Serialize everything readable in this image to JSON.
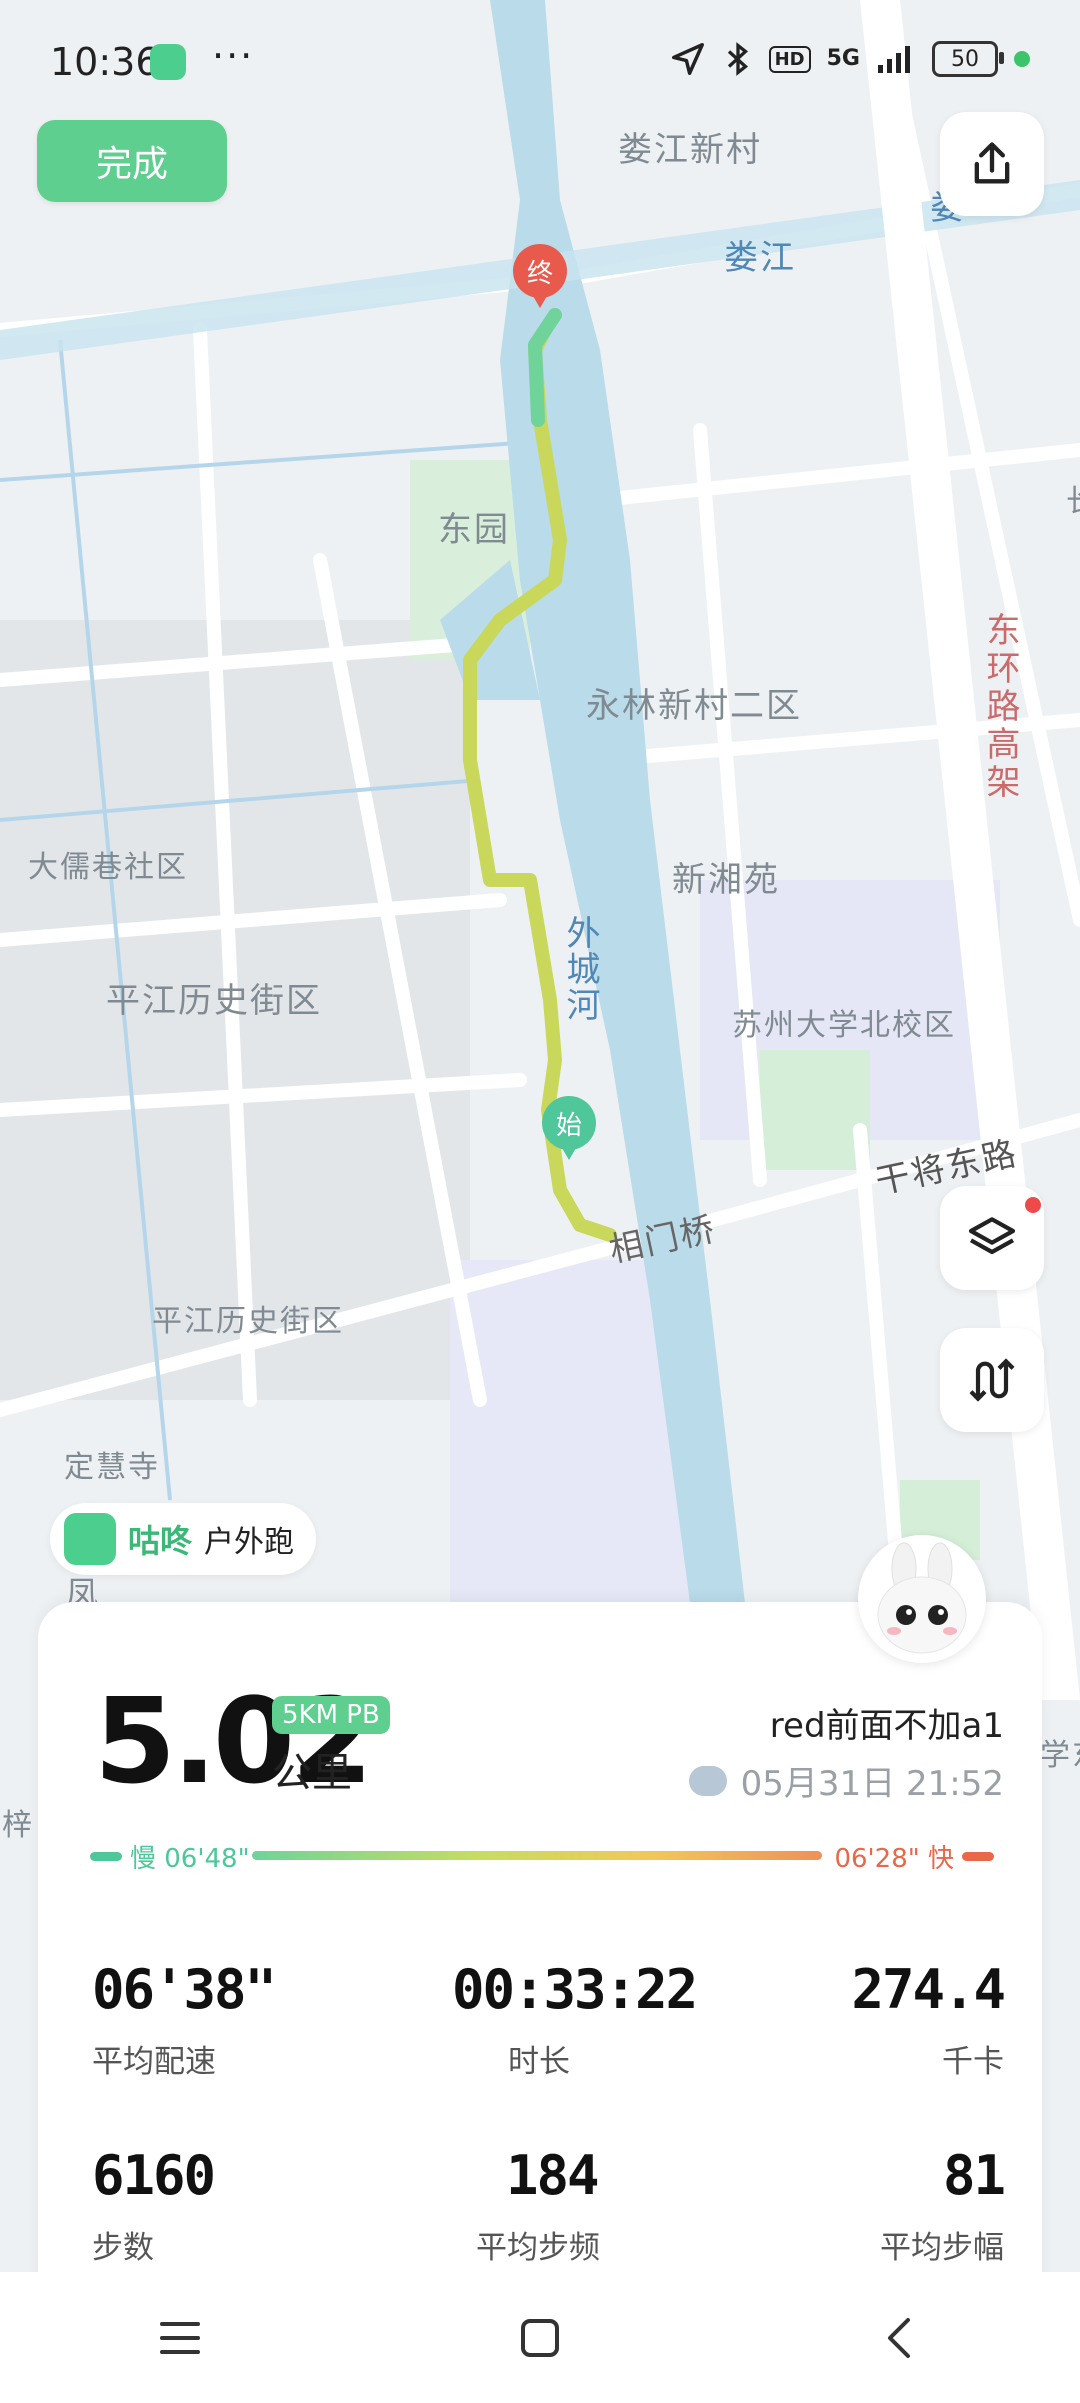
{
  "status_bar": {
    "time": "10:36",
    "more": "···",
    "net": "5G",
    "hd": "HD",
    "battery": "50"
  },
  "actions": {
    "done_label": "完成"
  },
  "map": {
    "labels": {
      "loujiang_village": "娄江新村",
      "loujiang": "娄江",
      "loujiang_edge": "娄",
      "dongyuan": "东园",
      "yonglin": "永林新村二区",
      "dongru": "大儒巷社区",
      "xinxiang": "新湘苑",
      "outer_river": "外城河",
      "pingjiang_top": "平江历史街区",
      "suda_north": "苏州大学北校区",
      "ganjiang_east": "干将东路",
      "xiangmen": "相门桥",
      "pingjiang_bottom": "平江历史街区",
      "dinghui": "定慧寺",
      "east_ring": "东环路高架",
      "edge_left": "梓",
      "edge_right": "学东",
      "edge_right_top": "长",
      "feng": "凤"
    },
    "pins": {
      "end": "终",
      "start": "始"
    },
    "route_colors": [
      "#6fd39a",
      "#c9d75a"
    ]
  },
  "brand": {
    "name": "咕咚",
    "activity": "户外跑"
  },
  "summary": {
    "distance": "5.02",
    "pb_badge": "5KM PB",
    "unit": "公里",
    "user": "red前面不加a1",
    "datetime": "05月31日 21:52",
    "pace_slow": "慢 06'48\"",
    "pace_fast": "06'28\" 快"
  },
  "stats": [
    {
      "value": "06'38\"",
      "label": "平均配速"
    },
    {
      "value": "00:33:22",
      "label": "时长"
    },
    {
      "value": "274.4",
      "label": "千卡"
    },
    {
      "value": "6160",
      "label": "步数"
    },
    {
      "value": "184",
      "label": "平均步频"
    },
    {
      "value": "81",
      "label": "平均步幅"
    }
  ],
  "colors": {
    "accent": "#5fcf8f",
    "river": "#b9dbea",
    "slow": "#4fc79a",
    "fast": "#e8684a"
  }
}
